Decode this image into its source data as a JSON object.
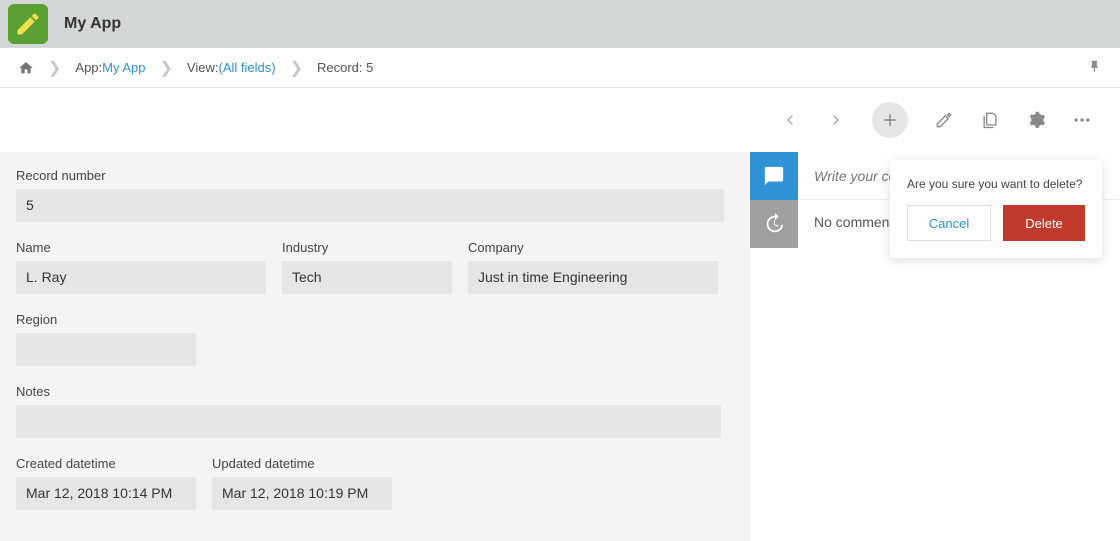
{
  "header": {
    "app_title": "My App"
  },
  "breadcrumb": {
    "app_prefix": "App: ",
    "app_link": "My App",
    "view_prefix": "View: ",
    "view_link": "(All fields)",
    "record_text": "Record: 5"
  },
  "record": {
    "fields": {
      "record_number_label": "Record number",
      "record_number_value": "5",
      "name_label": "Name",
      "name_value": "L. Ray",
      "industry_label": "Industry",
      "industry_value": "Tech",
      "company_label": "Company",
      "company_value": "Just in time Engineering",
      "region_label": "Region",
      "region_value": "",
      "notes_label": "Notes",
      "notes_value": "",
      "created_label": "Created datetime",
      "created_value": "Mar 12, 2018 10:14 PM",
      "updated_label": "Updated datetime",
      "updated_value": "Mar 12, 2018 10:19 PM"
    }
  },
  "comments": {
    "placeholder": "Write your comme",
    "empty_text": "No comments are available."
  },
  "popover": {
    "message": "Are you sure you want to delete?",
    "cancel_label": "Cancel",
    "delete_label": "Delete"
  }
}
